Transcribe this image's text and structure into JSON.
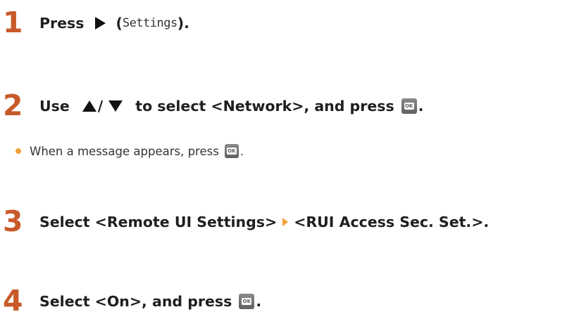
{
  "steps": [
    {
      "number": "1",
      "text_before": "Press",
      "key_label": "Settings",
      "paren_open": "(",
      "paren_close": ")."
    },
    {
      "number": "2",
      "text_use": "Use",
      "slash": "/",
      "text_mid": "to select <Network>, and press",
      "text_end": "."
    },
    {
      "number": "3",
      "text_a": "Select <Remote UI Settings>",
      "text_b": "<RUI Access Sec. Set.>."
    },
    {
      "number": "4",
      "text_a": "Select <On>, and press",
      "text_end": "."
    }
  ],
  "note": {
    "text": "When a message appears, press",
    "text_end": "."
  },
  "icons": {
    "ok_label": "OK"
  },
  "colors": {
    "step_number": "#c85a2a",
    "bullet": "#f2a03a",
    "text": "#1f1f1f"
  }
}
